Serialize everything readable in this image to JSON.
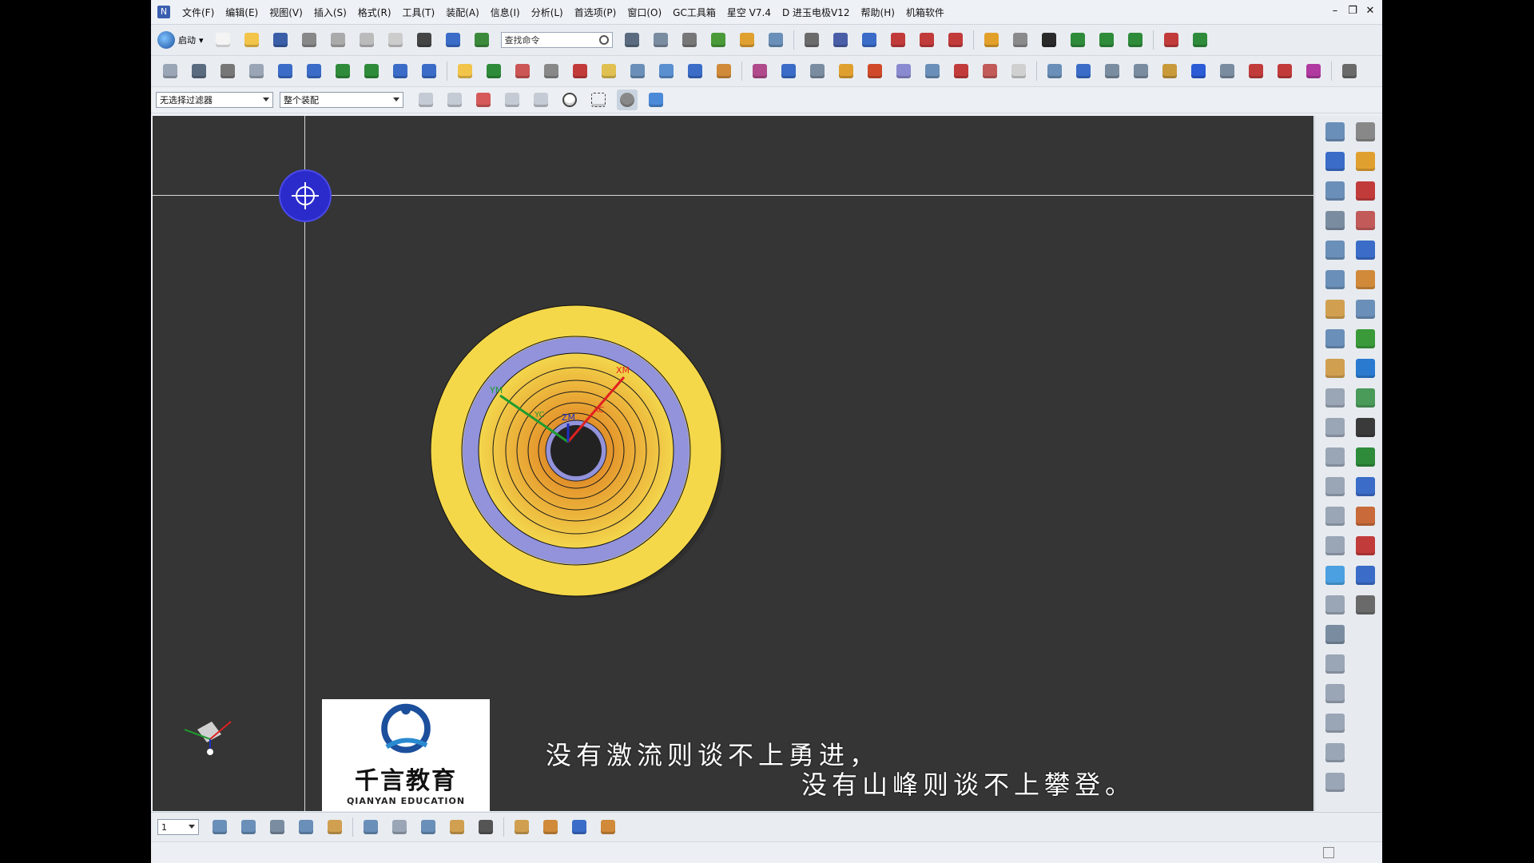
{
  "menubar": {
    "items": [
      "文件(F)",
      "编辑(E)",
      "视图(V)",
      "插入(S)",
      "格式(R)",
      "工具(T)",
      "装配(A)",
      "信息(I)",
      "分析(L)",
      "首选项(P)",
      "窗口(O)",
      "GC工具箱",
      "星空 V7.4",
      "D 进玉电极V12",
      "帮助(H)",
      "机箱软件"
    ],
    "window_controls": [
      "–",
      "❐",
      "✕"
    ]
  },
  "toolbar1": {
    "start_label": "启动",
    "search_placeholder": "查找命令",
    "icon_colors": [
      "#f4f4f4",
      "#f2c44a",
      "#3a5ea8",
      "#888888",
      "#aaaaaa",
      "#bbbbbb",
      "#cccccc",
      "#444444",
      "#3a6cc8",
      "#3b8a3b",
      "#5a6b80",
      "#7a8ca0",
      "#777777",
      "#4a9a3a",
      "#e0a030",
      "#6a8fb8",
      "#6b6b6b",
      "#4a5ea8",
      "#3a6cc8",
      "#c23b3b",
      "#c23b3b",
      "#c23b3b",
      "#e2a02a",
      "#8a8a8a",
      "#2a2a2a",
      "#2e8b3a",
      "#2e8b3a",
      "#2e8b3a",
      "#c23b3b",
      "#2e8b3a"
    ]
  },
  "toolbar2": {
    "icon_colors": [
      "#9aa5b5",
      "#5a6b80",
      "#777777",
      "#9aa5b5",
      "#3a6cc8",
      "#3a6cc8",
      "#2e8b3a",
      "#2e8b3a",
      "#3a6cc8",
      "#3a6cc8",
      "#f2c44a",
      "#2e8b3a",
      "#cc5555",
      "#888888",
      "#c23b3b",
      "#e0c050",
      "#6a8fb8",
      "#5a8fd0",
      "#3a6cc8",
      "#d08a3a",
      "#b04a8a",
      "#3a6cc8",
      "#7a8ca0",
      "#e0a030",
      "#d04a2a",
      "#8a8ad0",
      "#6a8fb8",
      "#c23b3b",
      "#c25a5a",
      "#d0d0d0",
      "#6a8fb8",
      "#3a6cc8",
      "#7a8ca0",
      "#7a8ca0",
      "#c89a3a",
      "#2b5cd6",
      "#7a8ca0",
      "#c23b3b",
      "#c23b3b",
      "#b03aa0",
      "#6a6a6a"
    ]
  },
  "toolbar3": {
    "filter_value": "无选择过滤器",
    "scope_value": "整个装配"
  },
  "viewport": {
    "axis_labels": {
      "xm": "XM",
      "ym": "YM",
      "zm": "ZM",
      "xc": "XC",
      "yc": "YC"
    },
    "ring_colors": {
      "yellow": "#f2d745",
      "lavender": "#8e8fd8",
      "hole": "#222222"
    }
  },
  "watermark": {
    "brand_cn": "千言教育",
    "brand_en": "QIANYAN EDUCATION"
  },
  "subtitles": {
    "line1": "没有激流则谈不上勇进，",
    "line2": "没有山峰则谈不上攀登。"
  },
  "rightbar": {
    "col1_colors": [
      "#6a8fb8",
      "#3a6cc8",
      "#6a8fb8",
      "#7a8ca0",
      "#6a8fb8",
      "#6a8fb8",
      "#d0a050",
      "#6a8fb8",
      "#d0a050",
      "#9aa5b5",
      "#9aa5b5",
      "#9aa5b5",
      "#9aa5b5",
      "#9aa5b5",
      "#9aa5b5",
      "#4aa0e0",
      "#9aa5b5",
      "#7a8ca0",
      "#9aa5b5",
      "#9aa5b5",
      "#9aa5b5",
      "#9aa5b5",
      "#9aa5b5"
    ],
    "col2_colors": [
      "#888888",
      "#e0a030",
      "#c23b3b",
      "#c25a5a",
      "#3a6cc8",
      "#d08a3a",
      "#6a8fb8",
      "#3a9a3a",
      "#2a7ad0",
      "#4a9a5a",
      "#3a3a3a",
      "#2e8b3a",
      "#3a6cc8",
      "#c86a3a",
      "#c23b3b",
      "#3a6cc8",
      "#6a6a6a"
    ]
  },
  "bottombar": {
    "layer_value": "1",
    "icon_colors": [
      "#6a8fb8",
      "#6a8fb8",
      "#7a8ca0",
      "#6a8fb8",
      "#d0a050",
      "#6a8fb8",
      "#9aa5b5",
      "#6a8fb8",
      "#d0a050",
      "#555555",
      "#d0a050",
      "#d08a3a",
      "#3a6cc8",
      "#d08a3a"
    ]
  }
}
